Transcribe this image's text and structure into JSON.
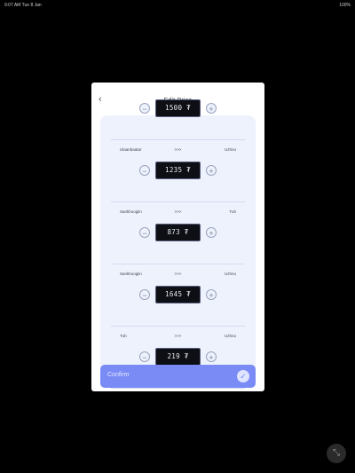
{
  "statusbar": {
    "left": "9:07 AM  Tue 8 Jan",
    "right": "100%"
  },
  "modal": {
    "title": "Edit Price",
    "rows": [
      {
        "value": "1500 ₮"
      },
      {
        "left_label": "Ulaanbaatar",
        "mid_label": ">>>",
        "right_label": "Uzhno",
        "value": "1235 ₮"
      },
      {
        "left_label": "Sankhoogiin",
        "mid_label": ">>>",
        "right_label": "Tuh",
        "value": "873 ₮"
      },
      {
        "left_label": "Sankhoogiin",
        "mid_label": ">>>",
        "right_label": "Uzhno",
        "value": "1645 ₮"
      },
      {
        "left_label": "Tuh",
        "mid_label": ">>>",
        "right_label": "Uzhno",
        "value": "219 ₮"
      }
    ],
    "confirm_label": "Confirm"
  },
  "icons": {
    "back": "chevron-left-icon",
    "minus": "minus-icon",
    "plus": "plus-icon",
    "confirm": "check-circle-icon",
    "corner": "expand-icon"
  },
  "colors": {
    "accent": "#7b8bf6",
    "panel": "#eef2fd",
    "display": "#0d0f14"
  }
}
